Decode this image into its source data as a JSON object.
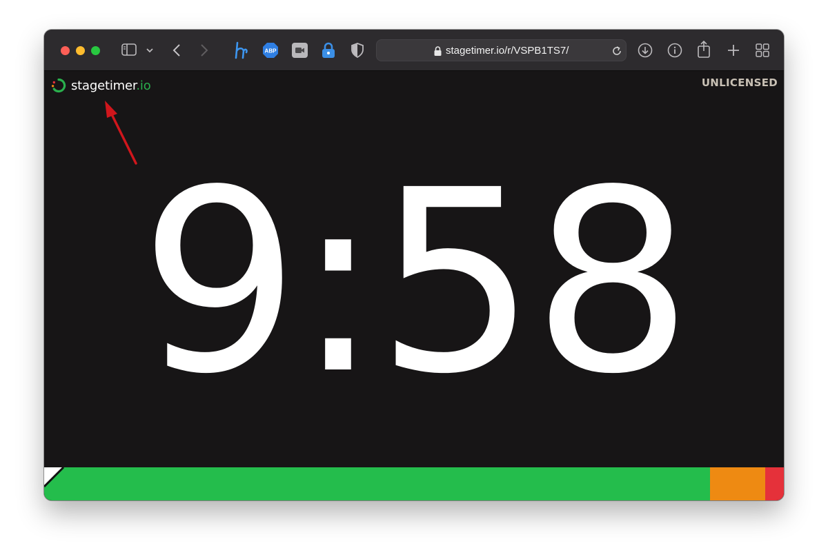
{
  "browser": {
    "url_text": "stagetimer.io/r/VSPB1TS7/",
    "toolbar_icons": [
      "sidebar-icon",
      "chevron-down-icon",
      "back-icon",
      "forward-icon",
      "honey-extension-icon",
      "adblock-extension-icon",
      "video-extension-icon",
      "lock-extension-icon",
      "shield-icon",
      "download-icon",
      "info-icon",
      "share-icon",
      "plus-icon",
      "tab-overview-icon"
    ]
  },
  "app": {
    "logo_name": "stagetimer",
    "logo_tld": ".io",
    "license_status": "UNLICENSED",
    "timer": "9:58"
  },
  "progress": {
    "segments": [
      {
        "name": "green",
        "color": "#24bd4c"
      },
      {
        "name": "orange",
        "color": "#ee8a12"
      },
      {
        "name": "red",
        "color": "#e5313a"
      }
    ]
  },
  "annotation": {
    "arrow_color": "#d0161c"
  },
  "colors": {
    "accent_green": "#2ab04d",
    "background": "#171516"
  }
}
